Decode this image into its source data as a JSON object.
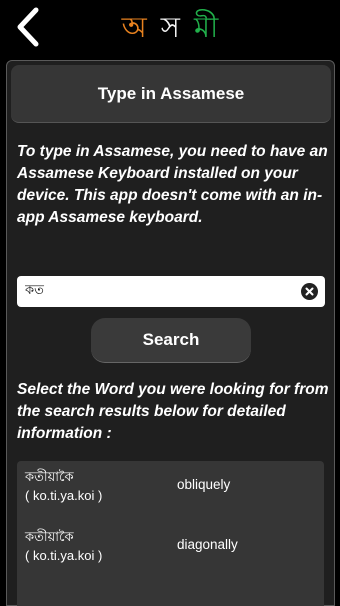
{
  "header": {
    "back_icon": "chevron-left-icon",
    "title_letters": [
      "অ",
      "স",
      "মী"
    ],
    "title_colors": [
      "#e8821f",
      "#f2f2f2",
      "#21b04b"
    ]
  },
  "panel": {
    "title": "Type in Assamese",
    "info_text": "To type in Assamese, you need to have an Assamese Keyboard installed on your device. This app doesn't come with an in-app Assamese keyboard.",
    "search_value": "কত",
    "clear_icon": "clear-circle-icon",
    "search_button": "Search",
    "select_hint": "Select the Word you were looking for from the search results below for detailed information :",
    "results": [
      {
        "word": "কতীয়াকৈ",
        "transliteration": "( ko.ti.ya.koi )",
        "meaning": "obliquely"
      },
      {
        "word": "কতীয়াকৈ",
        "transliteration": "( ko.ti.ya.koi )",
        "meaning": "diagonally"
      }
    ]
  }
}
